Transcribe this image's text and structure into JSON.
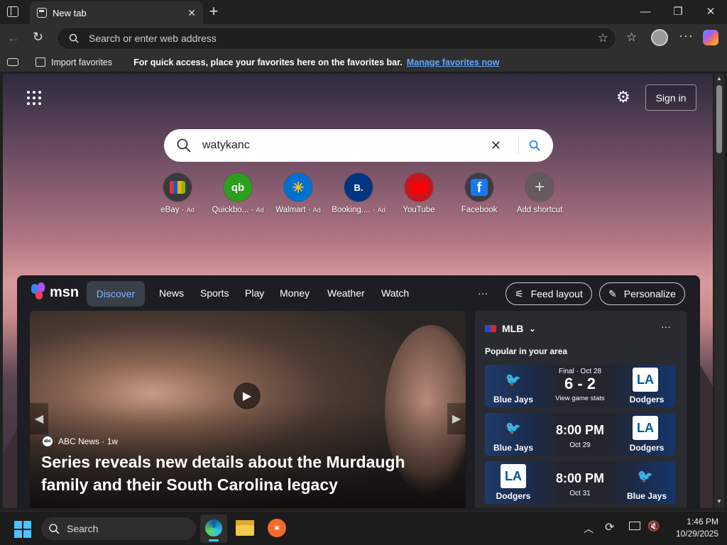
{
  "browser": {
    "tab_title": "New tab",
    "address_placeholder": "Search or enter web address"
  },
  "favorites_bar": {
    "import_label": "Import favorites",
    "message": "For quick access, place your favorites here on the favorites bar.",
    "manage_link": "Manage favorites now"
  },
  "newtab": {
    "sign_in": "Sign in",
    "search_query": "watykanc",
    "shortcuts": [
      {
        "label": "eBay",
        "ad": "Ad",
        "icon": "ebay-icon",
        "color": "#ffffff"
      },
      {
        "label": "Quickbo...",
        "ad": "Ad",
        "icon": "quickbooks-icon",
        "color": "#2ca01c"
      },
      {
        "label": "Walmart",
        "ad": "Ad",
        "icon": "walmart-icon",
        "color": "#0071ce"
      },
      {
        "label": "Booking....",
        "ad": "Ad",
        "icon": "booking-icon",
        "color": "#003580"
      },
      {
        "label": "YouTube",
        "ad": "",
        "icon": "youtube-icon",
        "color": "#ff0000"
      },
      {
        "label": "Facebook",
        "ad": "",
        "icon": "facebook-icon",
        "color": "#1877f2"
      },
      {
        "label": "Add shortcut",
        "ad": "",
        "icon": "add-icon",
        "color": "#5a5a5a"
      }
    ]
  },
  "feed": {
    "brand": "msn",
    "tabs": [
      "Discover",
      "News",
      "Sports",
      "Play",
      "Money",
      "Weather",
      "Watch"
    ],
    "more": "···",
    "feed_layout": "Feed layout",
    "personalize": "Personalize",
    "hero": {
      "source": "ABC News",
      "age": "1w",
      "headline": "Series reveals new details about the Murdaugh family and their South Carolina legacy"
    },
    "mlb": {
      "title": "MLB",
      "subtitle": "Popular in your area",
      "games": [
        {
          "home": "Blue Jays",
          "away": "Dodgers",
          "status": "Final · Oct 28",
          "main": "6 - 2",
          "sub": "View game stats"
        },
        {
          "home": "Blue Jays",
          "away": "Dodgers",
          "status": "",
          "main": "8:00 PM",
          "sub": "Oct 29"
        },
        {
          "home": "Dodgers",
          "away": "Blue Jays",
          "status": "",
          "main": "8:00 PM",
          "sub": "Oct 31"
        }
      ]
    }
  },
  "taskbar": {
    "search_placeholder": "Search",
    "time": "1:46 PM",
    "date": "10/29/2025"
  }
}
